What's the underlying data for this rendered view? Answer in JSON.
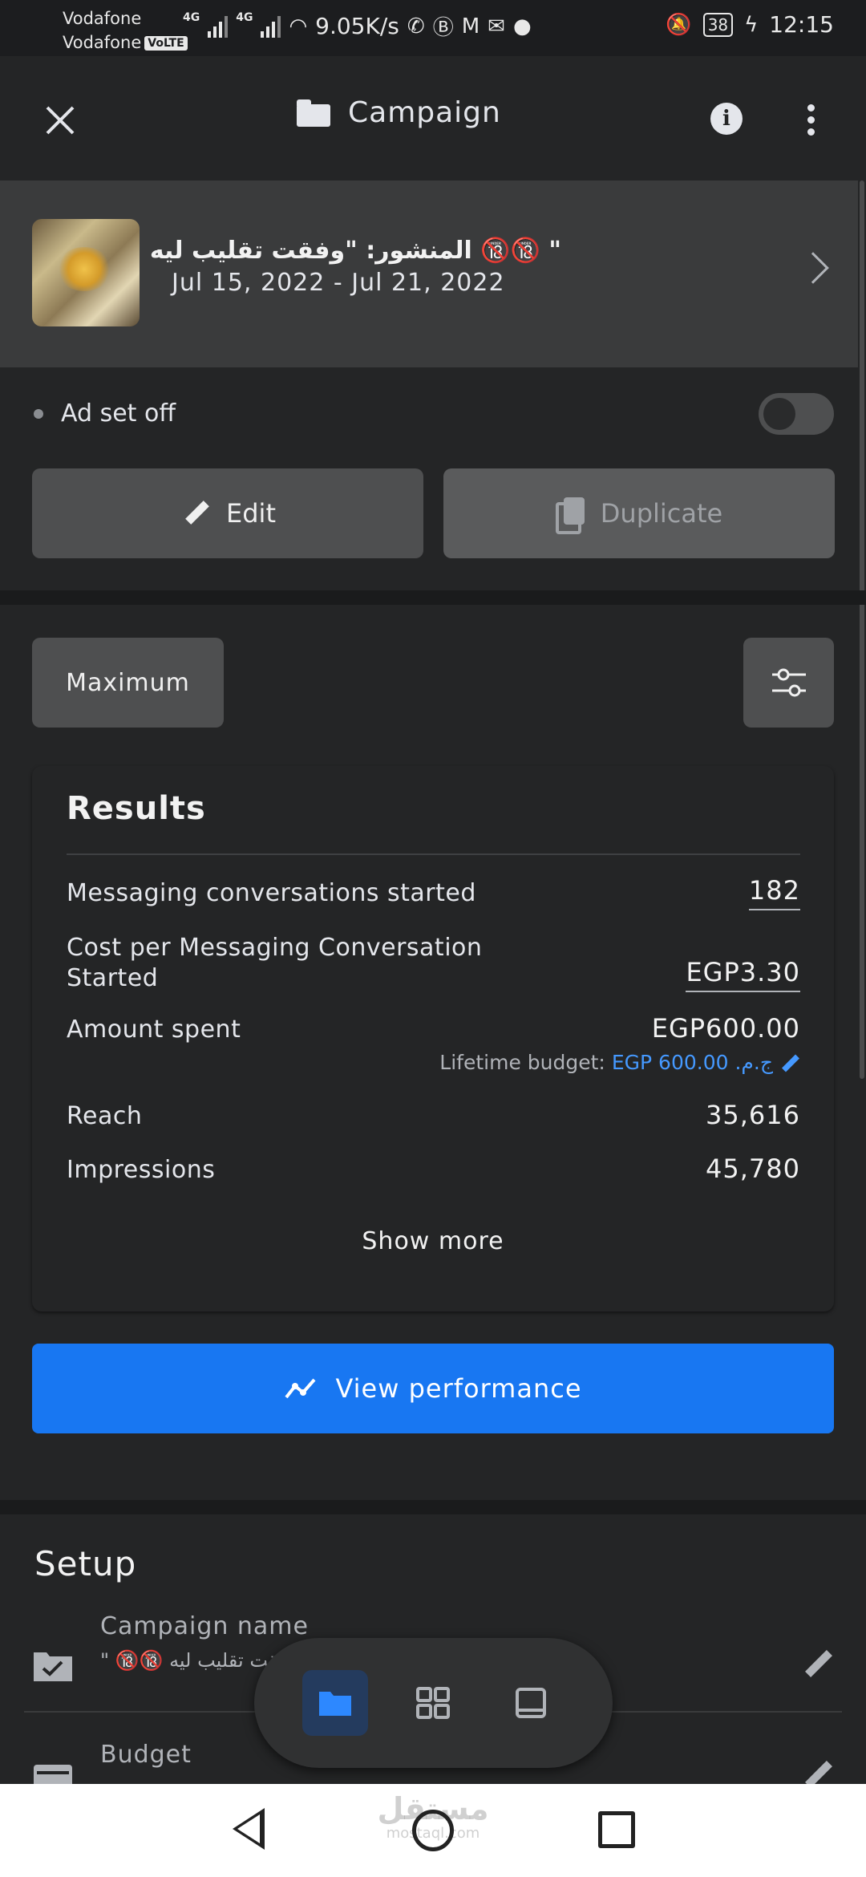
{
  "status_bar": {
    "carrier1": "Vodafone",
    "carrier2": "Vodafone",
    "volte": "VoLTE",
    "net1": "4G",
    "net2": "4G",
    "speed": "9.05K/s",
    "battery": "38",
    "time": "12:15"
  },
  "header": {
    "title": "Campaign"
  },
  "ad": {
    "title": "المنشور: \"وفقت تقليب ليه 🔞🔞 \"",
    "dates": "Jul 15, 2022 - Jul 21, 2022"
  },
  "adset": {
    "status_label": "Ad set off",
    "toggle_on": false
  },
  "actions": {
    "edit_label": "Edit",
    "duplicate_label": "Duplicate"
  },
  "filter": {
    "maximum_label": "Maximum"
  },
  "results": {
    "title": "Results",
    "rows": [
      {
        "label": "Messaging conversations started",
        "value": "182"
      },
      {
        "label": "Cost per Messaging Conversation Started",
        "value": "EGP3.30"
      },
      {
        "label": "Amount spent",
        "value": "EGP600.00"
      },
      {
        "label": "Reach",
        "value": "35,616"
      },
      {
        "label": "Impressions",
        "value": "45,780"
      }
    ],
    "budget_prefix": "Lifetime budget:",
    "budget_value": "EGP ج.م. 600.00",
    "show_more": "Show more"
  },
  "view_performance": "View performance",
  "setup": {
    "title": "Setup",
    "campaign_name_label": "Campaign name",
    "campaign_name_value": "\" 🔞🔞 وفقت تقليب ليه",
    "budget_label": "Budget"
  },
  "watermark": {
    "arabic": "مستقل",
    "latin": "mostaql.com"
  },
  "colors": {
    "accent": "#1877f2",
    "link_blue": "#4599ff",
    "background": "#242526",
    "card": "#3a3b3c"
  }
}
